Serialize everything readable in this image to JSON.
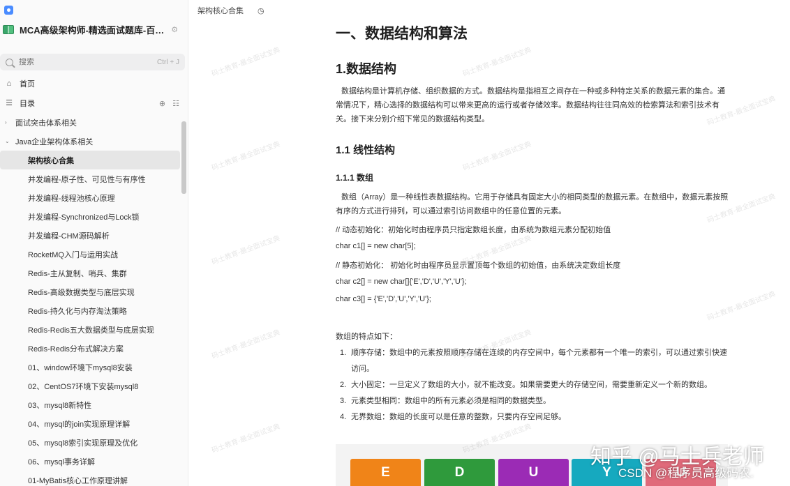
{
  "sidebar": {
    "book_title": "MCA高级架构师-精选面试题库-百…",
    "search": {
      "placeholder": "搜索",
      "shortcut": "Ctrl + J"
    },
    "nav": {
      "home": "首页",
      "toc": "目录"
    },
    "tree": [
      {
        "label": "面试突击体系相关",
        "level": 1,
        "caret": "›"
      },
      {
        "label": "Java企业架构体系相关",
        "level": 1,
        "caret": "⌄"
      },
      {
        "label": "架构核心合集",
        "level": 2,
        "active": true
      },
      {
        "label": "并发编程-原子性、可见性与有序性",
        "level": 2
      },
      {
        "label": "并发编程-线程池核心原理",
        "level": 2
      },
      {
        "label": "并发编程-Synchronized与Lock锁",
        "level": 2
      },
      {
        "label": "并发编程-CHM源码解析",
        "level": 2
      },
      {
        "label": "RocketMQ入门与运用实战",
        "level": 2
      },
      {
        "label": "Redis-主从复制、哨兵、集群",
        "level": 2
      },
      {
        "label": "Redis-高级数据类型与底层实现",
        "level": 2
      },
      {
        "label": "Redis-持久化与内存淘汰策略",
        "level": 2
      },
      {
        "label": "Redis-Redis五大数据类型与底层实现",
        "level": 2
      },
      {
        "label": "Redis-Redis分布式解决方案",
        "level": 2
      },
      {
        "label": "01、window环境下mysql8安装",
        "level": 2
      },
      {
        "label": "02、CentOS7环境下安装mysql8",
        "level": 2
      },
      {
        "label": "03、mysql8新特性",
        "level": 2
      },
      {
        "label": "04、mysql的join实现原理详解",
        "level": 2
      },
      {
        "label": "05、mysql8索引实现原理及优化",
        "level": 2
      },
      {
        "label": "06、mysql事务详解",
        "level": 2
      },
      {
        "label": "01-MyBatis核心工作原理讲解",
        "level": 2
      }
    ]
  },
  "topbar": {
    "breadcrumb": "架构核心合集"
  },
  "doc": {
    "h1": "一、数据结构和算法",
    "h2": "1.数据结构",
    "intro": "数据结构是计算机存储、组织数据的方式。数据结构是指相互之间存在一种或多种特定关系的数据元素的集合。通常情况下，精心选择的数据结构可以带来更高的运行或者存储效率。数据结构往往同高效的检索算法和索引技术有关。接下来分别介绍下常见的数据结构类型。",
    "h3": "1.1 线性结构",
    "h4": "1.1.1 数组",
    "array_desc": "数组（Array）是一种线性表数据结构。它用于存储具有固定大小的相同类型的数据元素。在数组中，数据元素按照有序的方式进行排列，可以通过索引访问数组中的任意位置的元素。",
    "code": [
      "// 动态初始化：初始化时由程序员只指定数组长度，由系统为数组元素分配初始值",
      "char c1[] = new char[5];",
      "// 静态初始化： 初始化时由程序员显示置顶每个数组的初始值，由系统决定数组长度",
      "char c2[] = new char[]{'E','D','U','Y','U'};",
      "char c3[] = {'E','D','U','Y','U'};"
    ],
    "features_title": "数组的特点如下：",
    "features": [
      {
        "num": "1.",
        "text": "顺序存储：数组中的元素按照顺序存储在连续的内存空间中，每个元素都有一个唯一的索引，可以通过索引快速访问。"
      },
      {
        "num": "2.",
        "text": "大小固定：一旦定义了数组的大小，就不能改变。如果需要更大的存储空间，需要重新定义一个新的数组。"
      },
      {
        "num": "3.",
        "text": "元素类型相同：数组中的所有元素必须是相同的数据类型。"
      },
      {
        "num": "4.",
        "text": "无界数组：数组的长度可以是任意的整数，只要内存空间足够。"
      }
    ],
    "tiles": [
      {
        "letter": "E",
        "color": "#f08418"
      },
      {
        "letter": "D",
        "color": "#2f9a3c"
      },
      {
        "letter": "U",
        "color": "#9b2bb5"
      },
      {
        "letter": "Y",
        "color": "#16a9bf"
      },
      {
        "letter": "U",
        "color": "#e06a7a"
      }
    ]
  },
  "overlay": {
    "zhihu": "知乎 @马士兵老师",
    "csdn": "CSDN @程序员高级码农."
  },
  "watermark": "码士教育-最全面试宝典"
}
